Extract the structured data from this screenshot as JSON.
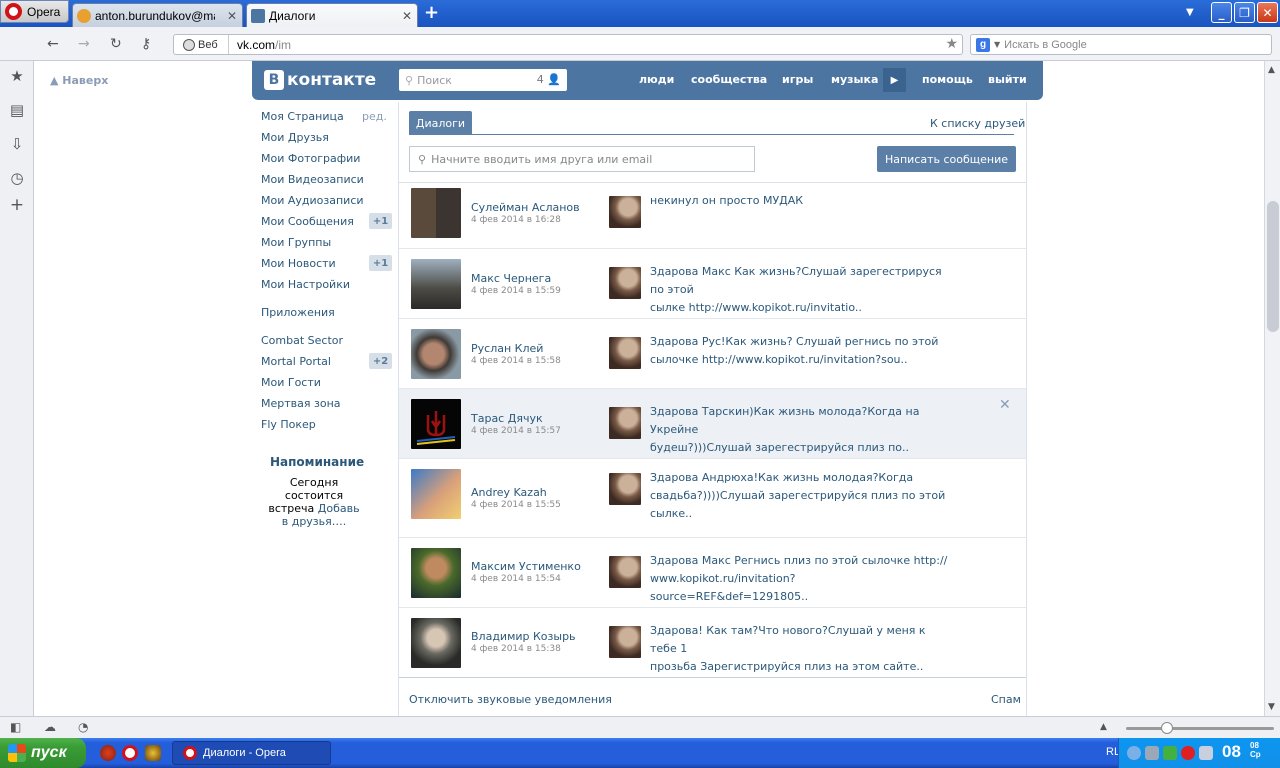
{
  "browser": {
    "opera_label": "Opera",
    "tabs": [
      {
        "label": "anton.burundukov@mail....",
        "active": false
      },
      {
        "label": "Диалоги",
        "active": true
      }
    ],
    "address": {
      "web_label": "Веб",
      "host": "vk.com",
      "path": "/im"
    },
    "search_placeholder": "Искать в Google"
  },
  "page": {
    "back_to_top": "Наверх",
    "header": {
      "logo": "контакте",
      "logo_letter": "В",
      "search_placeholder": "Поиск",
      "search_count": "4",
      "nav": [
        "люди",
        "сообщества",
        "игры",
        "музыка",
        "помощь",
        "выйти"
      ]
    },
    "left_menu": {
      "items": [
        {
          "label": "Моя Страница",
          "extra": "ред.",
          "badge": ""
        },
        {
          "label": "Мои Друзья",
          "badge": ""
        },
        {
          "label": "Мои Фотографии",
          "badge": ""
        },
        {
          "label": "Мои Видеозаписи",
          "badge": ""
        },
        {
          "label": "Мои Аудиозаписи",
          "badge": ""
        },
        {
          "label": "Мои Сообщения",
          "badge": "+1"
        },
        {
          "label": "Мои Группы",
          "badge": ""
        },
        {
          "label": "Мои Новости",
          "badge": "+1"
        },
        {
          "label": "Мои Настройки",
          "badge": ""
        }
      ],
      "apps_label": "Приложения",
      "apps": [
        {
          "label": "Combat Sector",
          "badge": ""
        },
        {
          "label": "Mortal Portal",
          "badge": "+2"
        },
        {
          "label": "Мои Гости",
          "badge": ""
        },
        {
          "label": "Мертвая зона",
          "badge": ""
        },
        {
          "label": "Fly Покер",
          "badge": ""
        }
      ],
      "reminder_title": "Напоминание",
      "reminder_prefix": "Сегодня состоится встреча",
      "reminder_link": "Добавь в друзья….",
      "reminder_suffix": ""
    },
    "dialogs": {
      "tab_label": "Диалоги",
      "friends_link": "К списку друзей",
      "search_placeholder": "Начните вводить имя друга или email",
      "write_button": "Написать сообщение",
      "rows": [
        {
          "name": "Сулейман Асланов",
          "date": "4 фев 2014 в 16:28",
          "lines": [
            "некинул он просто МУДАК"
          ]
        },
        {
          "name": "Макс Чернега",
          "date": "4 фев 2014 в 15:59",
          "lines": [
            "Здарова Макс Как жизнь?Слушай зарегестрируся по этой",
            "сылке http://www.kopikot.ru/invitatio.."
          ]
        },
        {
          "name": "Руслан Клей",
          "date": "4 фев 2014 в 15:58",
          "lines": [
            "Здарова Рус!Как жизнь? Слушай регнись по этой",
            "сылочке http://www.kopikot.ru/invitation?sou.."
          ]
        },
        {
          "name": "Тарас Дячук",
          "date": "4 фев 2014 в 15:57",
          "lines": [
            "Здарова Тарскин)Как жизнь молода?Когда на Укрейне",
            "будеш?)))Слушай зарегестрируйся плиз по.."
          ]
        },
        {
          "name": "Andrey Kazah",
          "date": "4 фев 2014 в 15:55",
          "lines": [
            "Здарова Андрюха!Как жизнь молодая?Когда",
            "свадьба?))))Слушай зарегестрируйся плиз по этой",
            "сылке.."
          ]
        },
        {
          "name": "Максим Устименко",
          "date": "4 фев 2014 в 15:54",
          "lines": [
            "Здарова Макс Регнись плиз по этой сылочке http://",
            "www.kopikot.ru/invitation?source=REF&def=1291805.."
          ]
        },
        {
          "name": "Владимир Козырь",
          "date": "4 фев 2014 в 15:38",
          "lines": [
            "Здарова! Как там?Что нового?Слушай у меня к тебе 1",
            "прозьба Зарегистрируйся плиз на этом сайте.."
          ]
        }
      ],
      "sound_off": "Отключить звуковые уведомления",
      "spam": "Спам"
    }
  },
  "taskbar": {
    "start_label": "пуск",
    "task_label": "Диалоги - Opera",
    "lang": "RL",
    "clock": "08",
    "clock_small_top": "08",
    "clock_small_bottom": "Ср"
  }
}
